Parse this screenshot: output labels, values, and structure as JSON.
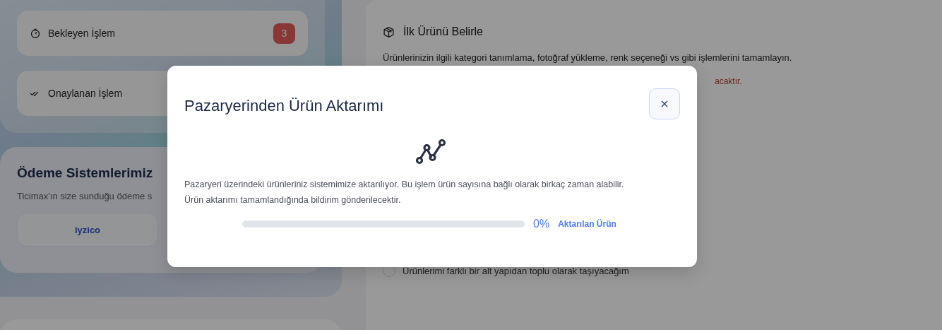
{
  "sidebar": {
    "stats": [
      {
        "kind": "pending",
        "label": "Bekleyen İşlem",
        "count": "3"
      },
      {
        "kind": "approved",
        "label": "Onaylanan İşlem"
      }
    ],
    "payment": {
      "title": "Ödeme Sistemlerimiz",
      "description": "Ticimax'ın size sunduğu ödeme s",
      "providers": [
        "iyzico"
      ]
    }
  },
  "main": {
    "title": "İlk Ürünü Belirle",
    "description": "Ürünlerinizin ilgili kategori tanımlama, fotoğraf yükleme, renk seçeneği vs gibi işlemlerini tamamlayın.",
    "warning": "acaktır.",
    "options": [
      {
        "label": "Ürünlerimi farklı bir alt yapıdan toplu olarak taşıyacağım",
        "selected": false
      }
    ]
  },
  "modal": {
    "title": "Pazaryerinden Ürün Aktarımı",
    "message": "Pazaryeri üzerindeki ürünleriniz sistemimize aktarılıyor. Bu işlem ürün sayısına bağlı olarak birkaç zaman alabilir.\nÜrün aktarımı tamamlandığında bildirim gönderilecektir.",
    "progress": {
      "level": 0,
      "percent": "0%",
      "label": "Aktarılan Ürün"
    }
  }
}
